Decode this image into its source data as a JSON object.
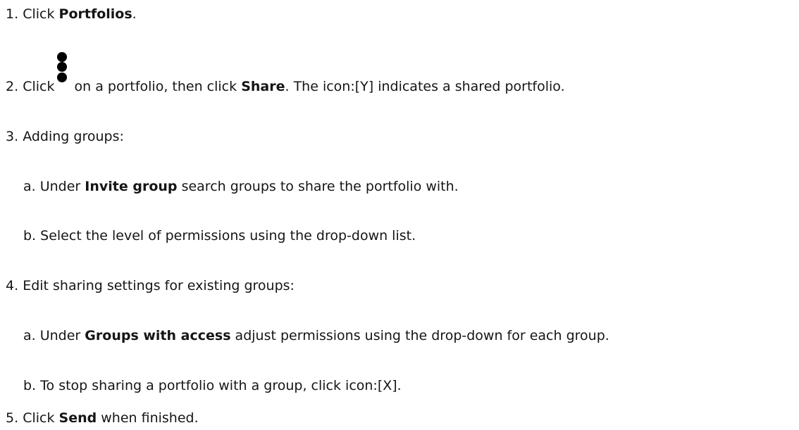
{
  "steps": {
    "s1": {
      "num": "1.",
      "pre": "Click ",
      "bold": "Portfolios",
      "post": "."
    },
    "s2": {
      "num": "2.",
      "pre": "Click",
      "icon": "kebab-menu-icon",
      "mid": " on a portfolio, then click ",
      "bold": "Share",
      "post": ". The icon:[Y] indicates a shared portfolio."
    },
    "s3": {
      "num": "3.",
      "text": "Adding groups:",
      "a": {
        "letter": "a.",
        "pre": "Under ",
        "bold": "Invite group",
        "post": " search groups to share the portfolio with."
      },
      "b": {
        "letter": "b.",
        "text": "Select the level of permissions using the drop-down list."
      }
    },
    "s4": {
      "num": "4.",
      "text": "Edit sharing settings for existing groups:",
      "a": {
        "letter": "a.",
        "pre": "Under ",
        "bold": "Groups with access",
        "post": " adjust permissions using the drop-down for each group."
      },
      "b": {
        "letter": "b.",
        "text": "To stop sharing a portfolio with a group, click icon:[X]."
      }
    },
    "s5": {
      "num": "5.",
      "pre": "Click ",
      "bold": "Send",
      "post": " when finished."
    }
  }
}
